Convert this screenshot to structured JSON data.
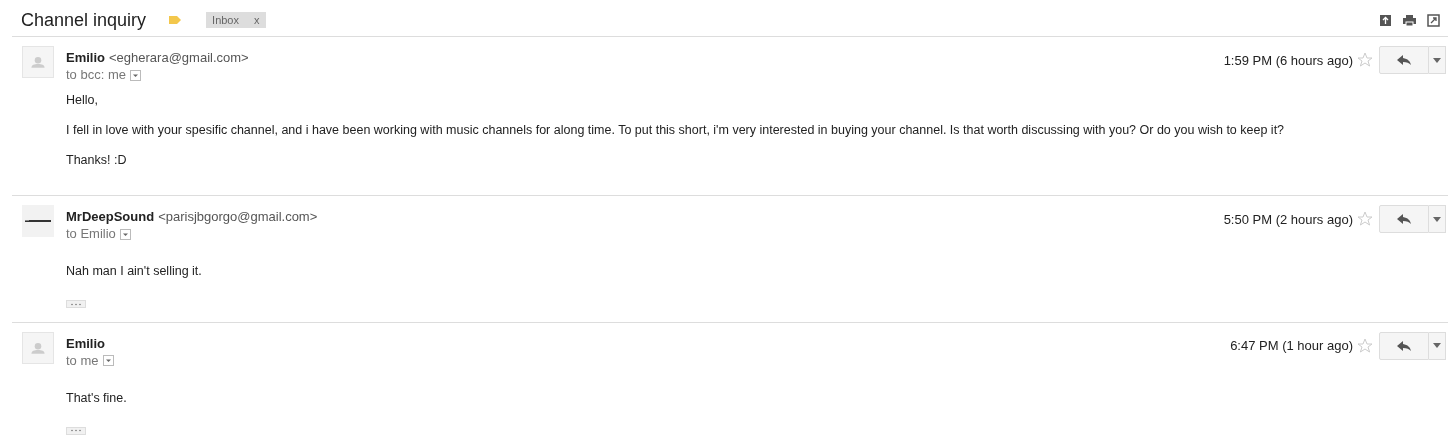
{
  "thread": {
    "subject": "Channel inquiry",
    "important": true,
    "labels": [
      {
        "name": "Inbox",
        "remove": "x"
      }
    ]
  },
  "messages": [
    {
      "avatar": {
        "kind": "default"
      },
      "sender": "Emilio",
      "email": "<egherara@gmail.com>",
      "to": "to bcc: me",
      "time": "1:59 PM (6 hours ago)",
      "starred": false,
      "body": [
        "Hello,",
        "I fell in love with your spesific channel, and i have been working with music channels for  along time. To put this short, i'm very interested in buying your channel. Is that worth discussing with you? Or do you wish to keep it?",
        "Thanks! :D"
      ],
      "trimmed": false
    },
    {
      "sender": "MrDeepSound",
      "email": "<parisjbgorgo@gmail.com>",
      "to": "to Emilio",
      "time": "5:50 PM (2 hours ago)",
      "starred": false,
      "body": [
        "Nah man I ain't selling it."
      ],
      "trimmed": true
    },
    {
      "avatar": {
        "kind": "default"
      },
      "sender": "Emilio",
      "to": "to me",
      "time": "6:47 PM (1 hour ago)",
      "starred": false,
      "body": [
        "That's fine."
      ],
      "trimmed": true
    }
  ]
}
